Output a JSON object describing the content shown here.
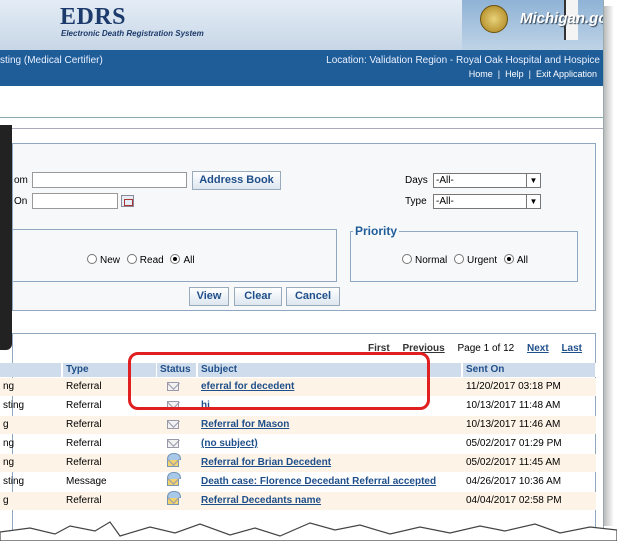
{
  "header": {
    "logo_title": "EDRS",
    "logo_subtitle": "Electronic Death Registration System",
    "brand": "Michigan.gov",
    "user_partial": "sting (Medical Certifier)",
    "location": "Location: Validation Region - Royal Oak Hospital and Hospice",
    "links": [
      "Home",
      "Help",
      "Exit Application"
    ]
  },
  "search": {
    "from_label_partial": "om",
    "address_book_button": "Address Book",
    "on_label_partial": "On",
    "days_label": "Days",
    "days_value": "-All-",
    "type_label": "Type",
    "type_value": "-All-",
    "read_options": [
      "New",
      "Read",
      "All"
    ],
    "read_selected": "All",
    "priority_legend": "Priority",
    "priority_options": [
      "Normal",
      "Urgent",
      "All"
    ],
    "priority_selected": "All",
    "buttons": {
      "view": "View",
      "clear": "Clear",
      "cancel": "Cancel"
    }
  },
  "results": {
    "pager": {
      "first": "First",
      "previous": "Previous",
      "page_text": "Page 1 of 12",
      "next": "Next",
      "last": "Last"
    },
    "columns": {
      "type": "Type",
      "status": "Status",
      "subject": "Subject",
      "sent_on": "Sent On"
    },
    "rows": [
      {
        "from": "ng",
        "type": "Referral",
        "status": "unread",
        "subject": "eferral for decedent",
        "sent": "11/20/2017 03:18 PM"
      },
      {
        "from": "sting",
        "type": "Referral",
        "status": "unread",
        "subject": "hi",
        "sent": "10/13/2017 11:48 AM"
      },
      {
        "from": "g",
        "type": "Referral",
        "status": "unread",
        "subject": "Referral for Mason",
        "sent": "10/13/2017 11:46 AM"
      },
      {
        "from": "ng",
        "type": "Referral",
        "status": "unread",
        "subject": "(no subject)",
        "sent": "05/02/2017 01:29 PM"
      },
      {
        "from": "ng",
        "type": "Referral",
        "status": "read",
        "subject": "Referral for Brian Decedent",
        "sent": "05/02/2017 11:45 AM"
      },
      {
        "from": "sting",
        "type": "Message",
        "status": "read",
        "subject": "Death case: Florence Decedant Referral accepted",
        "sent": "04/26/2017 10:36 AM"
      },
      {
        "from": "g",
        "type": "Referral",
        "status": "read",
        "subject": "Referral Decedants name",
        "sent": "04/04/2017 02:58 PM"
      }
    ]
  },
  "colors": {
    "brand_blue": "#1f5d99",
    "highlight_red": "#e02020",
    "row_alt": "#fdf3e6"
  }
}
